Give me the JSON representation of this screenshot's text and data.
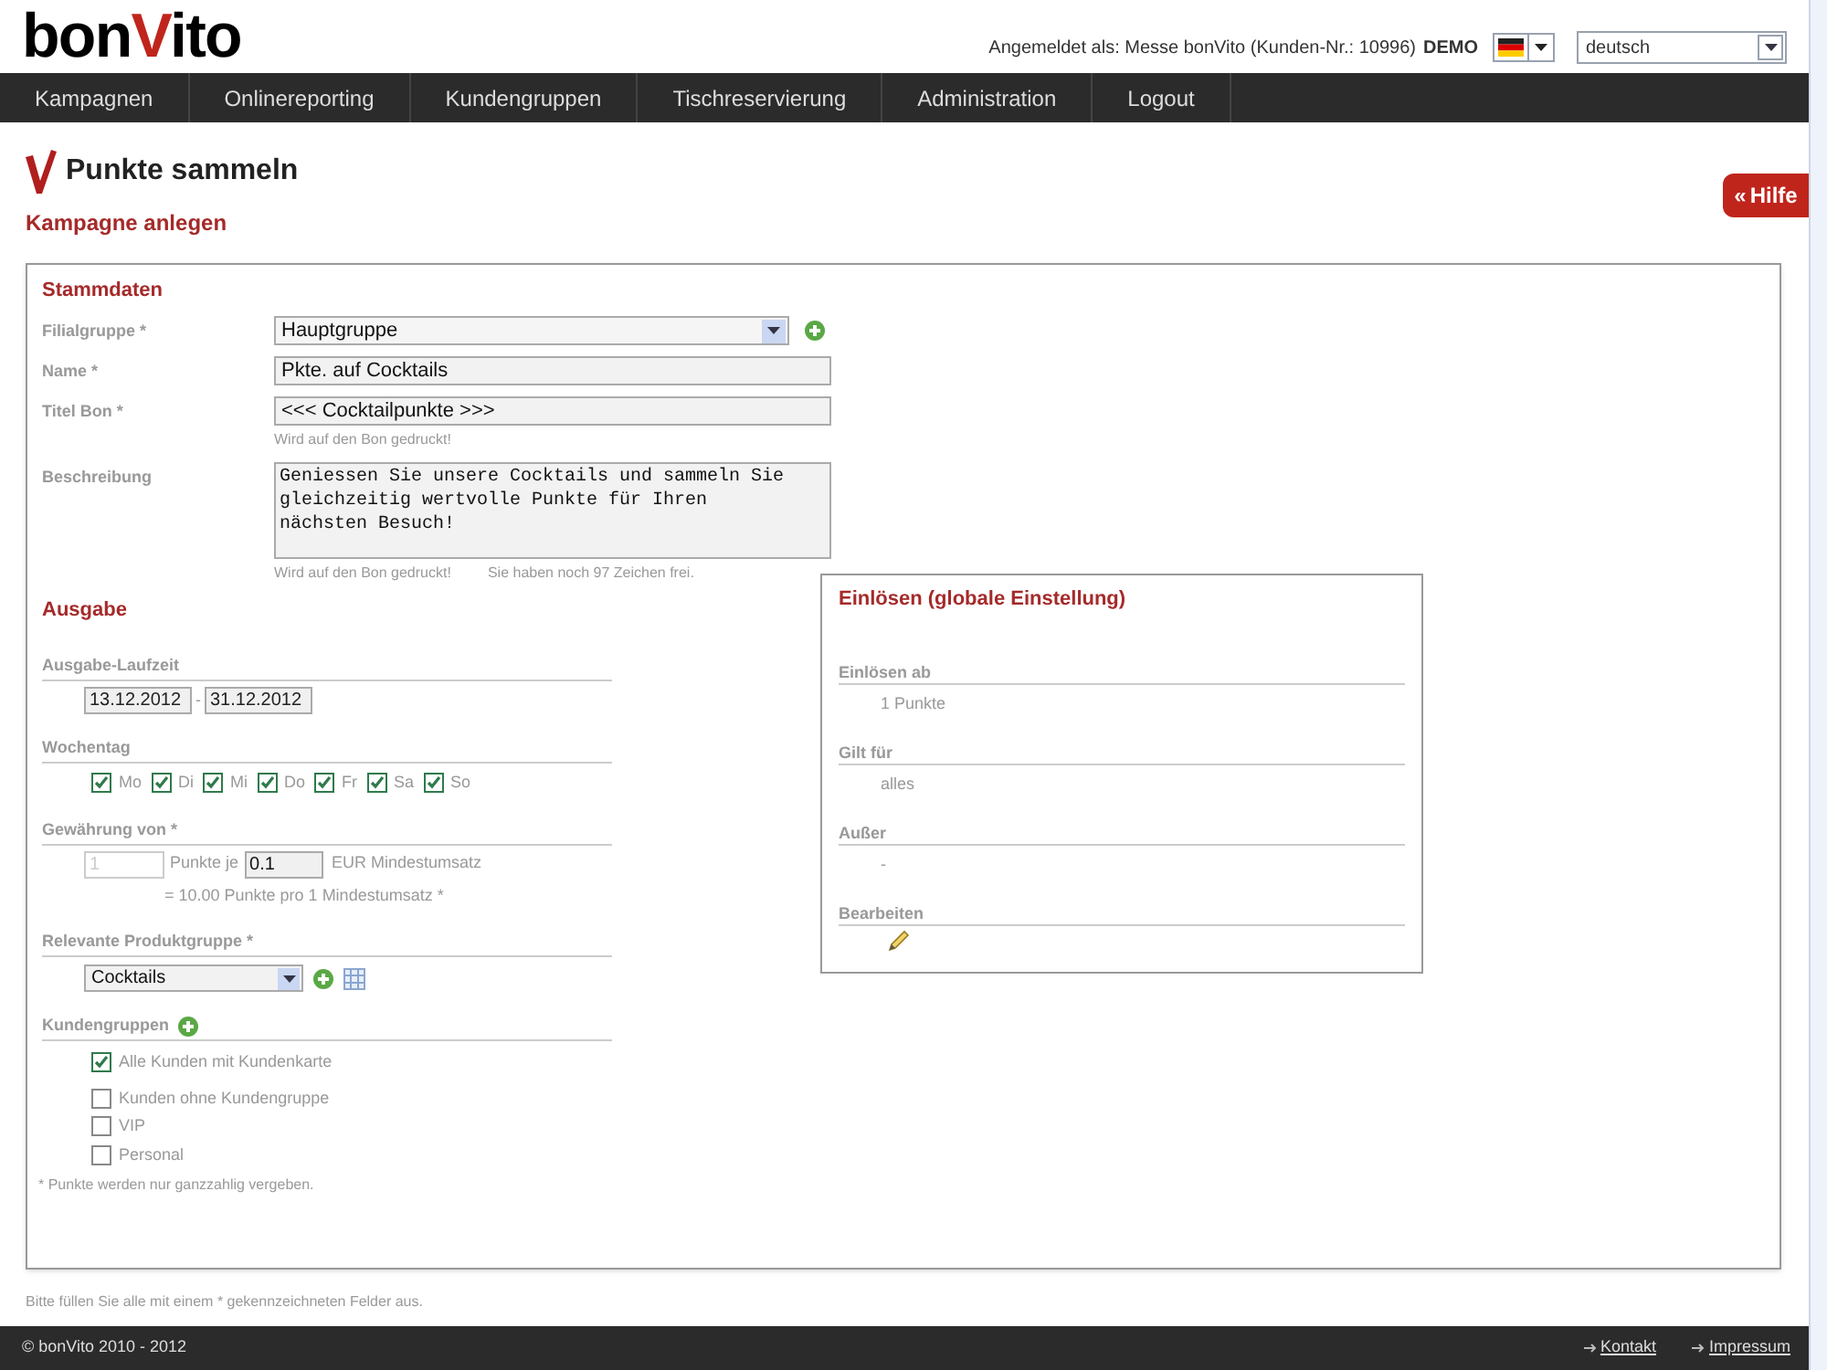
{
  "header": {
    "logo_parts": [
      {
        "text": "bon",
        "accent": false
      },
      {
        "text": "V",
        "accent": true
      },
      {
        "text": "ito",
        "accent": false
      }
    ],
    "login_label": "Angemeldet als: Messe bonVito (Kunden-Nr.: 10996)",
    "login_badge": "DEMO",
    "language": "deutsch"
  },
  "nav": [
    {
      "label": "Kampagnen"
    },
    {
      "label": "Onlinereporting"
    },
    {
      "label": "Kundengruppen"
    },
    {
      "label": "Tischreservierung"
    },
    {
      "label": "Administration"
    },
    {
      "label": "Logout"
    }
  ],
  "page": {
    "title": "Punkte sammeln",
    "subtitle": "Kampagne anlegen",
    "help_icon": "«",
    "help": "Hilfe"
  },
  "stammdaten": {
    "title": "Stammdaten",
    "fields": [
      {
        "kind": "select",
        "label": "Filialgruppe *",
        "value": "Hauptgruppe",
        "add": true
      },
      {
        "kind": "input",
        "label": "Name *",
        "value": "Pkte. auf Cocktails"
      },
      {
        "kind": "input",
        "label": "Titel Bon *",
        "value": "<<< Cocktailpunkte >>>",
        "hints": [
          "Wird auf den Bon gedruckt!"
        ]
      },
      {
        "kind": "textarea",
        "label": "Beschreibung",
        "value": "Geniessen Sie unsere Cocktails und sammeln Sie gleichzeitig wertvolle Punkte für Ihren nächsten Besuch!",
        "hints": [
          "Wird auf den Bon gedruckt!",
          "Sie haben noch 97 Zeichen frei."
        ]
      }
    ]
  },
  "ausgabe": {
    "title": "Ausgabe",
    "laufzeit_label": "Ausgabe-Laufzeit",
    "date_from": "13.12.2012",
    "date_sep": "-",
    "date_to": "31.12.2012",
    "wochentag_label": "Wochentag",
    "weekdays": [
      {
        "label": "Mo",
        "checked": true
      },
      {
        "label": "Di",
        "checked": true
      },
      {
        "label": "Mi",
        "checked": true
      },
      {
        "label": "Do",
        "checked": true
      },
      {
        "label": "Fr",
        "checked": true
      },
      {
        "label": "Sa",
        "checked": true
      },
      {
        "label": "So",
        "checked": true
      }
    ],
    "gewaehrung_label": "Gewährung von *",
    "points": "1",
    "points_disabled": true,
    "points_text": "Punkte je",
    "amount": "0.1",
    "amount_text": "EUR Mindestumsatz",
    "calc_note": "= 10.00 Punkte pro 1 Mindestumsatz *",
    "produktgruppe_label": "Relevante Produktgruppe *",
    "produktgruppe": "Cocktails",
    "kundengruppen_label": "Kundengruppen",
    "kundengruppen": [
      {
        "label": "Alle Kunden mit Kundenkarte",
        "checked": true
      },
      {
        "label": "Kunden ohne Kundengruppe",
        "checked": false
      },
      {
        "label": "VIP",
        "checked": false
      },
      {
        "label": "Personal",
        "checked": false
      }
    ],
    "footnote": "* Punkte werden nur ganzzahlig vergeben."
  },
  "einloesen": {
    "title": "Einlösen (globale Einstellung)",
    "rows": [
      {
        "kind": "text",
        "label": "Einlösen ab",
        "value": "1 Punkte"
      },
      {
        "kind": "text",
        "label": "Gilt für",
        "value": "alles"
      },
      {
        "kind": "text",
        "label": "Außer",
        "value": "-"
      },
      {
        "kind": "edit",
        "label": "Bearbeiten"
      }
    ]
  },
  "required_note": "Bitte füllen Sie alle mit einem * gekennzeichneten Felder aus.",
  "footer": {
    "copyright": "© bonVito 2010 - 2012",
    "links": [
      {
        "label": "Kontakt"
      },
      {
        "label": "Impressum"
      }
    ]
  }
}
